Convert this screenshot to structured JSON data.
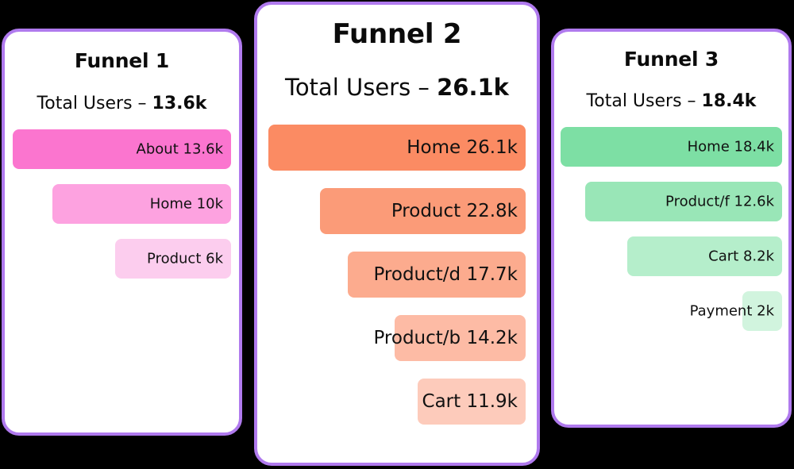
{
  "page": {
    "background_color": "#000000",
    "card_border_color": "#b07aee",
    "card_background": "#ffffff"
  },
  "chart_data": {
    "type": "bar",
    "title": "",
    "layout": "three funnel cards, horizontal right-aligned bars, descending widths",
    "charts": [
      {
        "title": "Funnel 1",
        "total_label": "Total Users –",
        "total_value": "13.6k",
        "accent": "#ff6ec7",
        "categories": [
          "About",
          "Home",
          "Product"
        ],
        "value_labels": [
          "13.6k",
          "10k",
          "6k"
        ],
        "values": [
          13600,
          10000,
          6000
        ],
        "max_value": 13600,
        "bars": [
          {
            "label": "About 13.6k",
            "name": "About",
            "value_label": "13.6k",
            "value": 13600,
            "pct": 100,
            "color": "#fb75cf"
          },
          {
            "label": "Home 10k",
            "name": "Home",
            "value_label": "10k",
            "value": 10000,
            "pct": 82,
            "color": "#fda2e0"
          },
          {
            "label": "Product 6k",
            "name": "Product",
            "value_label": "6k",
            "value": 6000,
            "pct": 53,
            "color": "#fccdee"
          }
        ]
      },
      {
        "title": "Funnel 2",
        "total_label": "Total Users –",
        "total_value": "26.1k",
        "accent": "#fb8b63",
        "categories": [
          "Home",
          "Product",
          "Product/d",
          "Product/b",
          "Cart"
        ],
        "value_labels": [
          "26.1k",
          "22.8k",
          "17.7k",
          "14.2k",
          "11.9k"
        ],
        "values": [
          26100,
          22800,
          17700,
          14200,
          11900
        ],
        "max_value": 26100,
        "bars": [
          {
            "label": "Home 26.1k",
            "name": "Home",
            "value_label": "26.1k",
            "value": 26100,
            "pct": 100,
            "color": "#fb8b63"
          },
          {
            "label": "Product 22.8k",
            "name": "Product",
            "value_label": "22.8k",
            "value": 22800,
            "pct": 80,
            "color": "#fb9b78"
          },
          {
            "label": "Product/d 17.7k",
            "name": "Product/d",
            "value_label": "17.7k",
            "value": 17700,
            "pct": 69,
            "color": "#fcab8e"
          },
          {
            "label": "Product/b 14.2k",
            "name": "Product/b",
            "value_label": "14.2k",
            "value": 14200,
            "pct": 51,
            "color": "#fdbba5"
          },
          {
            "label": "Cart 11.9k",
            "name": "Cart",
            "value_label": "11.9k",
            "value": 11900,
            "pct": 42,
            "color": "#fdcbbb"
          }
        ]
      },
      {
        "title": "Funnel 3",
        "total_label": "Total Users –",
        "total_value": "18.4k",
        "accent": "#79dfa4",
        "categories": [
          "Home",
          "Product/f",
          "Cart",
          "Payment"
        ],
        "value_labels": [
          "18.4k",
          "12.6k",
          "8.2k",
          "2k"
        ],
        "values": [
          18400,
          12600,
          8200,
          2000
        ],
        "max_value": 18400,
        "bars": [
          {
            "label": "Home 18.4k",
            "name": "Home",
            "value_label": "18.4k",
            "value": 18400,
            "pct": 100,
            "color": "#7ddfa4"
          },
          {
            "label": "Product/f 12.6k",
            "name": "Product/f",
            "value_label": "12.6k",
            "value": 12600,
            "pct": 89,
            "color": "#99e6b7"
          },
          {
            "label": "Cart 8.2k",
            "name": "Cart",
            "value_label": "8.2k",
            "value": 8200,
            "pct": 70,
            "color": "#b5eecb"
          },
          {
            "label": "Payment 2k",
            "name": "Payment",
            "value_label": "2k",
            "value": 2000,
            "pct": 18,
            "color": "#d1f4de"
          }
        ]
      }
    ]
  }
}
